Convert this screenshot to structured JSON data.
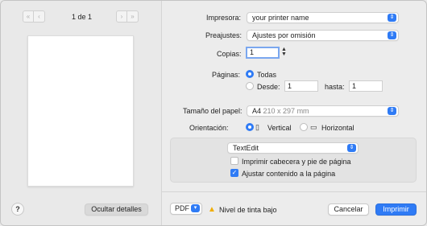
{
  "preview": {
    "page_indicator": "1 de 1",
    "first_icon": "double-chevron-left",
    "prev_icon": "chevron-left",
    "next_icon": "chevron-right",
    "last_icon": "double-chevron-right"
  },
  "left_footer": {
    "help_label": "?",
    "hide_details_label": "Ocultar detalles"
  },
  "form": {
    "printer_label": "Impresora:",
    "printer_value": "your printer name",
    "presets_label": "Preajustes:",
    "presets_value": "Ajustes por omisión",
    "copies_label": "Copias:",
    "copies_value": "1",
    "pages_label": "Páginas:",
    "pages_all_label": "Todas",
    "pages_from_label": "Desde:",
    "pages_from_value": "1",
    "pages_to_label": "hasta:",
    "pages_to_value": "1",
    "paper_size_label": "Tamaño del papel:",
    "paper_size_value": "A4",
    "paper_size_dims": "210 x 297 mm",
    "orientation_label": "Orientación:",
    "orientation_vertical": "Vertical",
    "orientation_horizontal": "Horizontal"
  },
  "app_options": {
    "app_select_value": "TextEdit",
    "print_header_footer_label": "Imprimir cabecera y pie de página",
    "print_header_footer_checked": false,
    "fit_content_label": "Ajustar contenido a la página",
    "fit_content_checked": true
  },
  "footer": {
    "pdf_label": "PDF",
    "ink_warning_label": "Nivel de tinta bajo",
    "cancel_label": "Cancelar",
    "print_label": "Imprimir"
  },
  "colors": {
    "accent": "#2f7bf5",
    "warning": "#f0ad00"
  }
}
